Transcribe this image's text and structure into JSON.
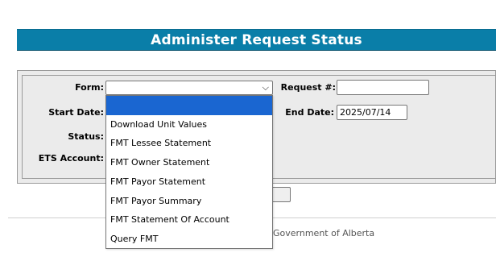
{
  "header": {
    "title": "Administer Request Status"
  },
  "form": {
    "form_label": "Form:",
    "request_label": "Request #:",
    "request_value": "",
    "start_date_label": "Start Date:",
    "end_date_label": "End Date:",
    "end_date_value": "2025/07/14",
    "status_label": "Status:",
    "ets_account_label": "ETS Account:",
    "form_selected_value": ""
  },
  "dropdown": {
    "options": [
      "",
      "Download Unit Values",
      "FMT Lessee Statement",
      "FMT Owner Statement",
      "FMT Payor Statement",
      "FMT Payor Summary",
      "FMT Statement Of Account",
      "Query FMT"
    ],
    "highlighted_index": 0,
    "highlight_color": "#1a66d1"
  },
  "footer": {
    "text": "Government of Alberta"
  },
  "colors": {
    "title_bar": "#0a7ea8",
    "panel": "#ebebeb"
  }
}
